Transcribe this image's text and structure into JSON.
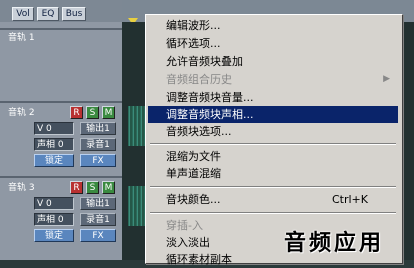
{
  "tabs": [
    "Vol",
    "EQ",
    "Bus"
  ],
  "tracks": [
    {
      "name": "音轨 1"
    },
    {
      "name": "音轨 2",
      "volume": "V 0",
      "out": "输出1",
      "phase": "声相 0",
      "record": "录音1",
      "lock": "锁定",
      "fx": "FX",
      "r": "R",
      "s": "S",
      "m": "M"
    },
    {
      "name": "音轨 3",
      "volume": "V 0",
      "out": "输出1",
      "phase": "声相 0",
      "record": "录音1",
      "lock": "锁定",
      "fx": "FX",
      "r": "R",
      "s": "S",
      "m": "M"
    }
  ],
  "menu": {
    "items": [
      "编辑波形...",
      "循环选项...",
      "允许音频块叠加",
      "音频组合历史",
      "调整音频块音量...",
      "调整音频块声相...",
      "音频块选项...",
      "混缩为文件",
      "单声道混缩",
      "音块颜色...",
      "Ctrl+K",
      "穿插-入",
      "淡入淡出",
      "循环素材副本"
    ]
  },
  "watermark": "音频应用"
}
